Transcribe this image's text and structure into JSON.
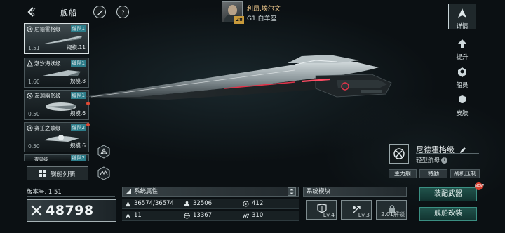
{
  "header": {
    "title": "舰船",
    "back_icon": "back-chevron-icon",
    "feather_icon": "feather-icon",
    "help_icon": "help-icon"
  },
  "captain": {
    "name": "利昂.埃尔文",
    "level": "28",
    "location": "G1.白羊座"
  },
  "ship_list": [
    {
      "name": "尼德霍格级",
      "fleet": "编队1",
      "value": "1.51",
      "scale": "规模.11",
      "selected": true,
      "alert": false
    },
    {
      "name": "潮汐海妖级",
      "fleet": "编队1",
      "value": "1.60",
      "scale": "规模.8",
      "selected": false,
      "alert": false
    },
    {
      "name": "海渊幽影级",
      "fleet": "编队1",
      "value": "0.50",
      "scale": "规模.6",
      "selected": false,
      "alert": true
    },
    {
      "name": "赛壬之歌级",
      "fleet": "编队2",
      "value": "0.50",
      "scale": "规模.6",
      "selected": false,
      "alert": true
    },
    {
      "name": "夜枭级",
      "fleet": "编队2",
      "value": "",
      "scale": "",
      "selected": false,
      "alert": false
    }
  ],
  "ship_list_button": {
    "label": "舰船列表",
    "icon": "grid-icon"
  },
  "side_nav": [
    {
      "label": "详情",
      "icon": "detail-icon",
      "active": true
    },
    {
      "label": "提升",
      "icon": "upgrade-icon",
      "active": false
    },
    {
      "label": "船员",
      "icon": "crew-icon",
      "active": false
    },
    {
      "label": "皮肤",
      "icon": "skin-icon",
      "active": false
    }
  ],
  "ship_info": {
    "name": "尼德霍格级",
    "type": "轻型航母",
    "tags": [
      "主力舰",
      "特勤",
      "战机压制"
    ]
  },
  "version": {
    "label": "版本号. 1.51"
  },
  "power": {
    "value": "48798"
  },
  "system_attributes": {
    "title": "系统属性",
    "values": {
      "hull": "36574/36574",
      "armor": "32506",
      "shield": "412",
      "speed": "11",
      "firepower": "13367",
      "energy": "310"
    }
  },
  "system_modules": {
    "title": "系统模块",
    "slots": [
      {
        "label": "Lv.4",
        "icon": "shield-module-icon"
      },
      {
        "label": "Lv.3",
        "icon": "thrust-module-icon"
      },
      {
        "label": "2.01解锁",
        "icon": "locked-module-icon"
      }
    ]
  },
  "actions": {
    "equip": "装配武器",
    "modify": "舰船改装",
    "new_badge": "NEW"
  },
  "colors": {
    "accent": "#2c7d8a",
    "action_green": "#22564e",
    "alert_red": "#e24a35"
  }
}
